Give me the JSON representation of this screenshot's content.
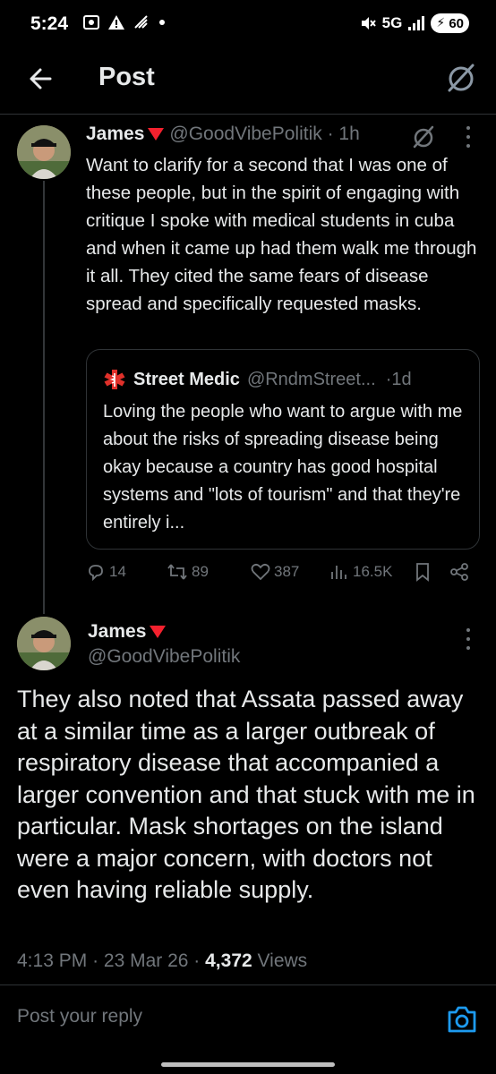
{
  "status_bar": {
    "time": "5:24",
    "network": "5G",
    "battery": "60"
  },
  "header": {
    "title": "Post",
    "back_icon": "back-arrow-icon",
    "grok_icon": "grok-icon"
  },
  "parent_post": {
    "name": "James",
    "handle": "@GoodVibePolitik",
    "time": "1h",
    "text": "Want to clarify for a second that I was one of these people, but in the spirit of engaging with critique I spoke with medical students in cuba and when it came up had them walk me through it all. They cited the same fears of disease spread and specifically requested masks.",
    "quote": {
      "name": "Street Medic",
      "handle": "@RndmStreet...",
      "time": "1d",
      "text": "Loving the people who want to argue with me about the risks of spreading disease being okay because a country has good hospital systems and \"lots of tourism\" and that they're entirely i..."
    },
    "stats": {
      "replies": "14",
      "reposts": "89",
      "likes": "387",
      "views": "16.5K"
    }
  },
  "main_post": {
    "name": "James",
    "handle": "@GoodVibePolitik",
    "text": "They also noted that Assata passed away at a similar time as a larger outbreak of respiratory disease that accompanied a larger convention and that stuck with me in particular. Mask shortages on the island were a major concern, with doctors not even having reliable supply.",
    "time": "4:13 PM",
    "date": "23 Mar 26",
    "views_count": "4,372",
    "views_label": "Views"
  },
  "reply": {
    "placeholder": "Post your reply"
  },
  "colors": {
    "background": "#000000",
    "text": "#e7e9ea",
    "muted": "#71767b",
    "accent": "#1d9bf0",
    "flag": "#f4212e"
  }
}
